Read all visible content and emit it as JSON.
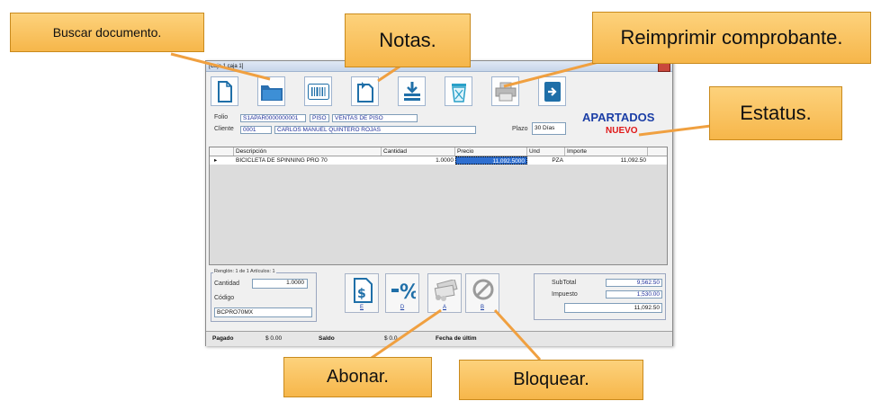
{
  "window": {
    "title": "[Caja 1 caja 1]"
  },
  "toolbar": [
    {
      "name": "new-document-icon"
    },
    {
      "name": "folder-icon"
    },
    {
      "name": "barcode-icon"
    },
    {
      "name": "notes-icon"
    },
    {
      "name": "stack-icon"
    },
    {
      "name": "recycle-bin-icon"
    },
    {
      "name": "printer-icon"
    },
    {
      "name": "exit-icon"
    }
  ],
  "header": {
    "folio_label": "Folio",
    "folio_value": "S1APAR0000000001",
    "piso_code": "PISO",
    "piso_desc": "VENTAS DE PISO",
    "cliente_label": "Cliente",
    "cliente_code": "0001",
    "cliente_name": "CARLOS MANUEL QUINTERO ROJAS",
    "plazo_label": "Plazo",
    "plazo_value": "30 Días"
  },
  "estatus": {
    "title": "APARTADOS",
    "state": "NUEVO"
  },
  "grid": {
    "columns": [
      "Descripción",
      "Cantidad",
      "Precio",
      "Und",
      "Importe"
    ],
    "rows": [
      {
        "descripcion": "BICICLETA DE SPINNING PRO 70",
        "cantidad": "1.0000",
        "precio": "11,092.5000",
        "und": "PZA",
        "importe": "11,092.50"
      }
    ]
  },
  "entry": {
    "legend": "Renglón: 1 de 1  Artículos: 1",
    "cantidad_label": "Cantidad",
    "cantidad_value": "1.0000",
    "codigo_label": "Código",
    "codigo_value": "BCPRO70MX"
  },
  "actions": [
    {
      "name": "pay-document-button",
      "key": "E"
    },
    {
      "name": "discount-button",
      "key": "D"
    },
    {
      "name": "abonar-button",
      "key": "A"
    },
    {
      "name": "bloquear-button",
      "key": "B"
    }
  ],
  "totals": {
    "subtotal_label": "SubTotal",
    "subtotal_value": "9,562.50",
    "impuesto_label": "Impuesto",
    "impuesto_value": "1,530.00",
    "total_value": "11,092.50"
  },
  "footer": {
    "pagado_label": "Pagado",
    "pagado_value": "$ 0.00",
    "saldo_label": "Saldo",
    "saldo_value": "$ 0.0",
    "fecha_label": "Fecha de últim"
  },
  "callouts": {
    "buscar": "Buscar documento.",
    "notas": "Notas.",
    "reimprimir": "Reimprimir comprobante.",
    "estatus": "Estatus.",
    "abonar": "Abonar.",
    "bloquear": "Bloquear."
  },
  "colors": {
    "callout_fill": "#f6b64a",
    "status_title": "#1b3ea6",
    "status_state": "#e01818",
    "arrow": "#f0a040"
  }
}
